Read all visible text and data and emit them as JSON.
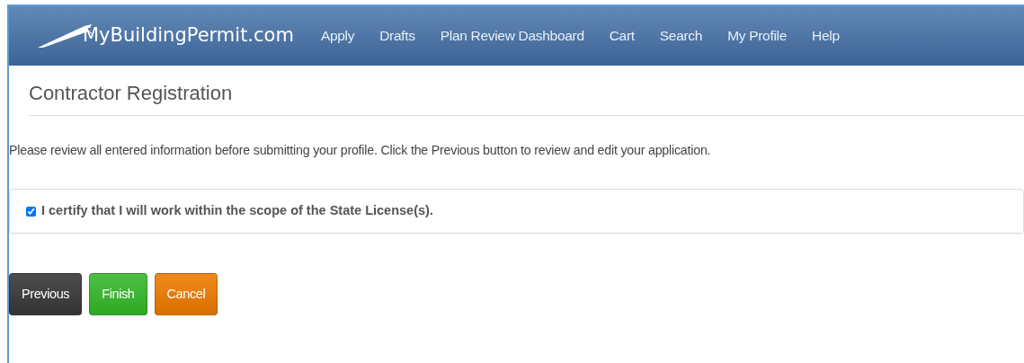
{
  "navbar": {
    "brand": "MyBuildingPermit.com",
    "links": [
      {
        "label": "Apply"
      },
      {
        "label": "Drafts"
      },
      {
        "label": "Plan Review Dashboard"
      },
      {
        "label": "Cart"
      },
      {
        "label": "Search"
      },
      {
        "label": "My Profile"
      },
      {
        "label": "Help"
      }
    ]
  },
  "page_title": "Contractor Registration",
  "instructions": "Please review all entered information before submitting your profile. Click the Previous button to review and edit your application.",
  "certification": {
    "label": "I certify that I will work within the scope of the State License(s).",
    "checked": true
  },
  "buttons": [
    {
      "label": "Previous",
      "kind": "dark"
    },
    {
      "label": "Finish",
      "kind": "success"
    },
    {
      "label": "Cancel",
      "kind": "warning"
    }
  ]
}
